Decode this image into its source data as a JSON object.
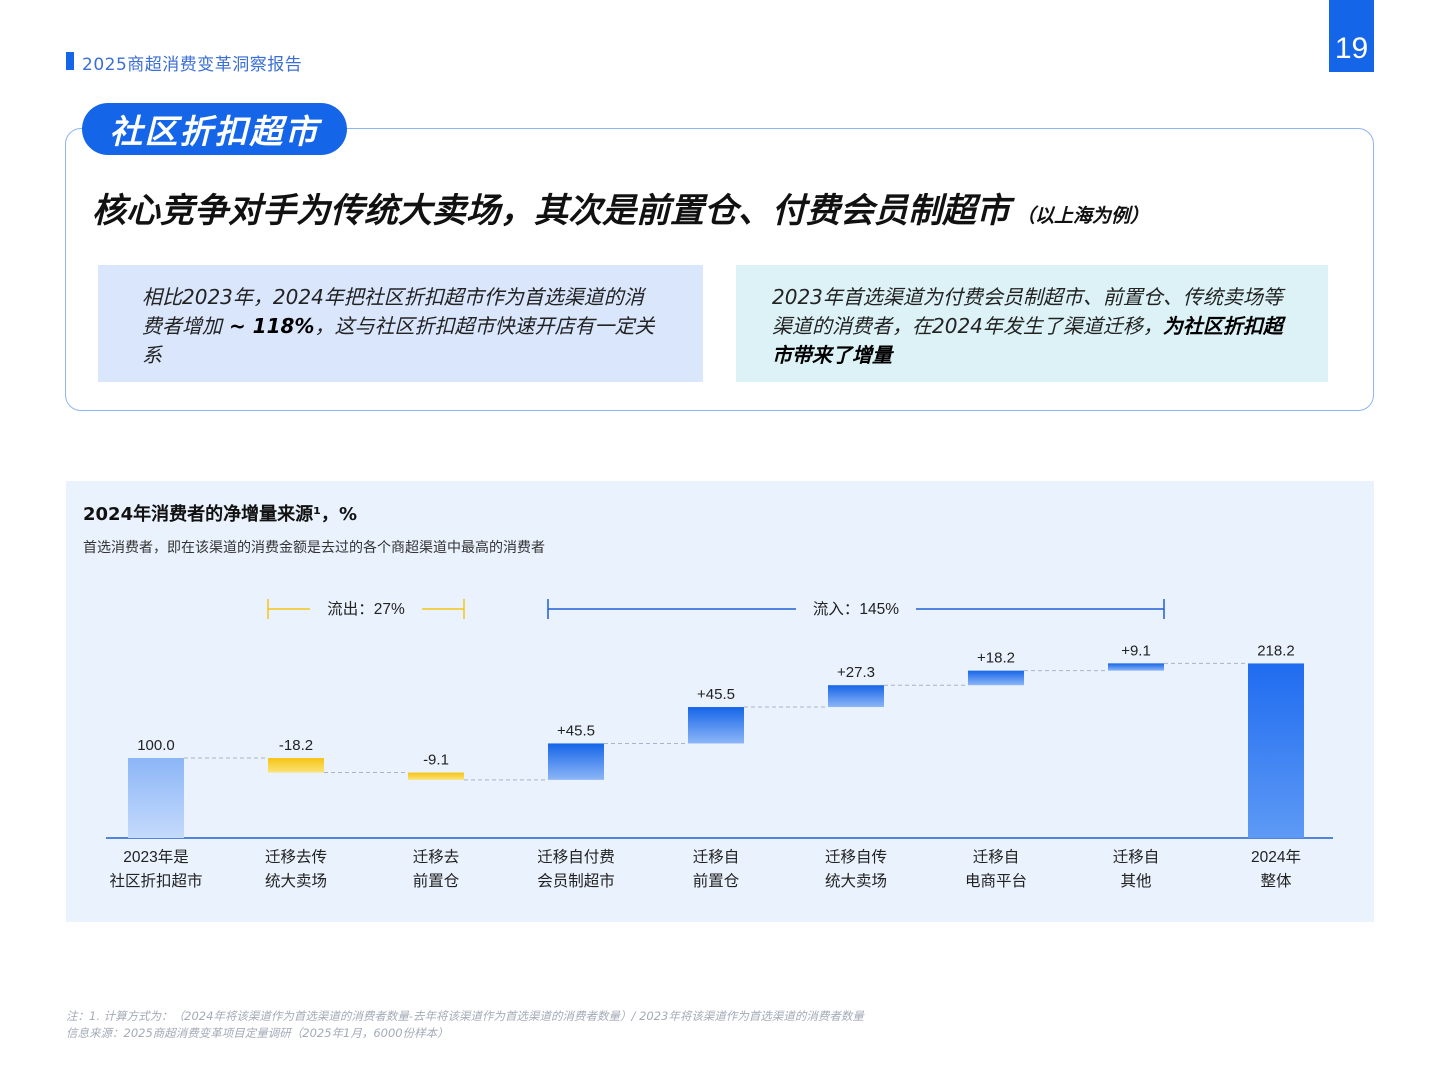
{
  "header": {
    "report_title": "2025商超消费变革洞察报告",
    "page_number": "19",
    "accent": "#1565e8"
  },
  "card": {
    "tag": "社区折扣超市",
    "headline": "核心竞争对手为传统大卖场，其次是前置仓、付费会员制超市",
    "headline_note": "（以上海为例）",
    "left_box": {
      "text_1": "相比2023年，2024年把社区折扣超市作为首选渠道的消费者增加",
      "bold": " ~ 118%",
      "text_2": "，这与社区折扣超市快速开店有一定关系"
    },
    "right_box": {
      "text_1": "2023年首选渠道为付费会员制超市、前置仓、传统卖场等渠道的消费者，在2024年发生了渠道迁移，",
      "bold": "为社区折扣超市带来了增量"
    }
  },
  "chart_data": {
    "type": "bar",
    "subtype": "waterfall",
    "title": "2024年消费者的净增量来源¹，%",
    "subtitle": "首选消费者，即在该渠道的消费金额是去过的各个商超渠道中最高的消费者",
    "categories": [
      [
        "2023年是",
        "社区折扣超市"
      ],
      [
        "迁移去传",
        "统大卖场"
      ],
      [
        "迁移去",
        "前置仓"
      ],
      [
        "迁移自付费",
        "会员制超市"
      ],
      [
        "迁移自",
        "前置仓"
      ],
      [
        "迁移自传",
        "统大卖场"
      ],
      [
        "迁移自",
        "电商平台"
      ],
      [
        "迁移自",
        "其他"
      ],
      [
        "2024年",
        "整体"
      ]
    ],
    "values": [
      100.0,
      -18.2,
      -9.1,
      45.5,
      45.5,
      27.3,
      18.2,
      9.1,
      218.2
    ],
    "labels": [
      "100.0",
      "-18.2",
      "-9.1",
      "+45.5",
      "+45.5",
      "+27.3",
      "+18.2",
      "+9.1",
      "218.2"
    ],
    "kinds": [
      "total",
      "decrease",
      "decrease",
      "increase",
      "increase",
      "increase",
      "increase",
      "increase",
      "total"
    ],
    "brackets": [
      {
        "label": "流出：27%",
        "from": 1,
        "to": 2,
        "color": "#f5c518"
      },
      {
        "label": "流入：145%",
        "from": 3,
        "to": 7,
        "color": "#1d5fd6"
      }
    ],
    "colors": {
      "increase": "#1565e8",
      "total": "#1f6cf0",
      "decrease": "#f5c518",
      "baseline": "#1d5fd6"
    }
  },
  "footnotes": {
    "note": "注：1. 计算方式为：（2024年将该渠道作为首选渠道的消费者数量-去年将该渠道作为首选渠道的消费者数量）/ 2023年将该渠道作为首选渠道的消费者数量",
    "source": "信息来源：2025商超消费变革项目定量调研（2025年1月，6000份样本）"
  }
}
